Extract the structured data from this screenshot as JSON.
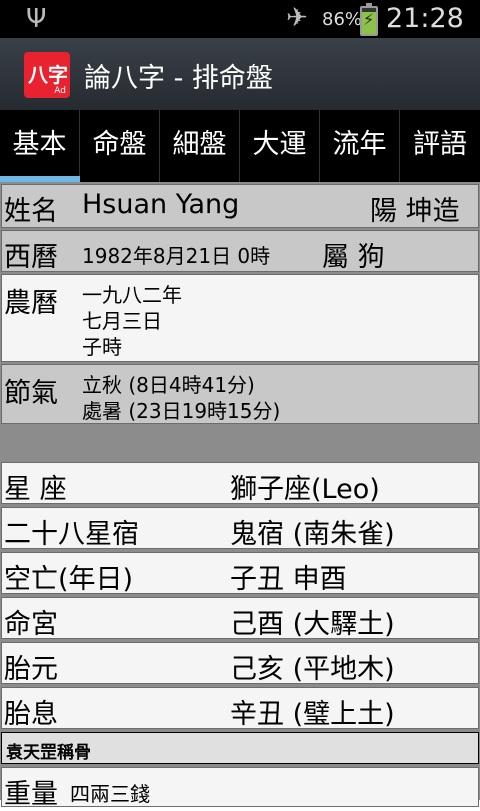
{
  "status": {
    "battery_pct": "86%",
    "battery_level": 0.86,
    "time": "21:28",
    "usb_icon": "usb-icon",
    "airplane_icon": "airplane-mode-icon"
  },
  "app": {
    "icon_text": "八字",
    "icon_badge": "Ad",
    "title": "論八字 - 排命盤"
  },
  "tabs": [
    {
      "label": "基本",
      "active": true
    },
    {
      "label": "命盤"
    },
    {
      "label": "細盤"
    },
    {
      "label": "大運"
    },
    {
      "label": "流年"
    },
    {
      "label": "評語"
    }
  ],
  "basic": {
    "name_label": "姓名",
    "name_value": "Hsuan Yang",
    "gender": "陽 坤造",
    "solar_label": "西曆",
    "solar_value": "1982年8月21日 0時",
    "zodiac": "屬 狗",
    "lunar_label": "農曆",
    "lunar_lines": [
      "一九八二年",
      "七月三日",
      "子時"
    ],
    "term_label": "節氣",
    "term_lines": [
      "立秋 (8日4時41分)",
      "處暑 (23日19時15分)"
    ]
  },
  "details": [
    {
      "label": "星 座",
      "value": "獅子座(Leo)"
    },
    {
      "label": "二十八星宿",
      "value": "鬼宿 (南朱雀)"
    },
    {
      "label": "空亡(年日)",
      "value": "子丑 申酉"
    },
    {
      "label": "命宮",
      "value": "己酉 (大驛土)"
    },
    {
      "label": "胎元",
      "value": "己亥 (平地木)"
    },
    {
      "label": "胎息",
      "value": "辛丑 (璧上土)"
    }
  ],
  "bone": {
    "section_title": "袁天罡稱骨",
    "weight_label": "重量",
    "weight_value": "四兩三錢"
  }
}
